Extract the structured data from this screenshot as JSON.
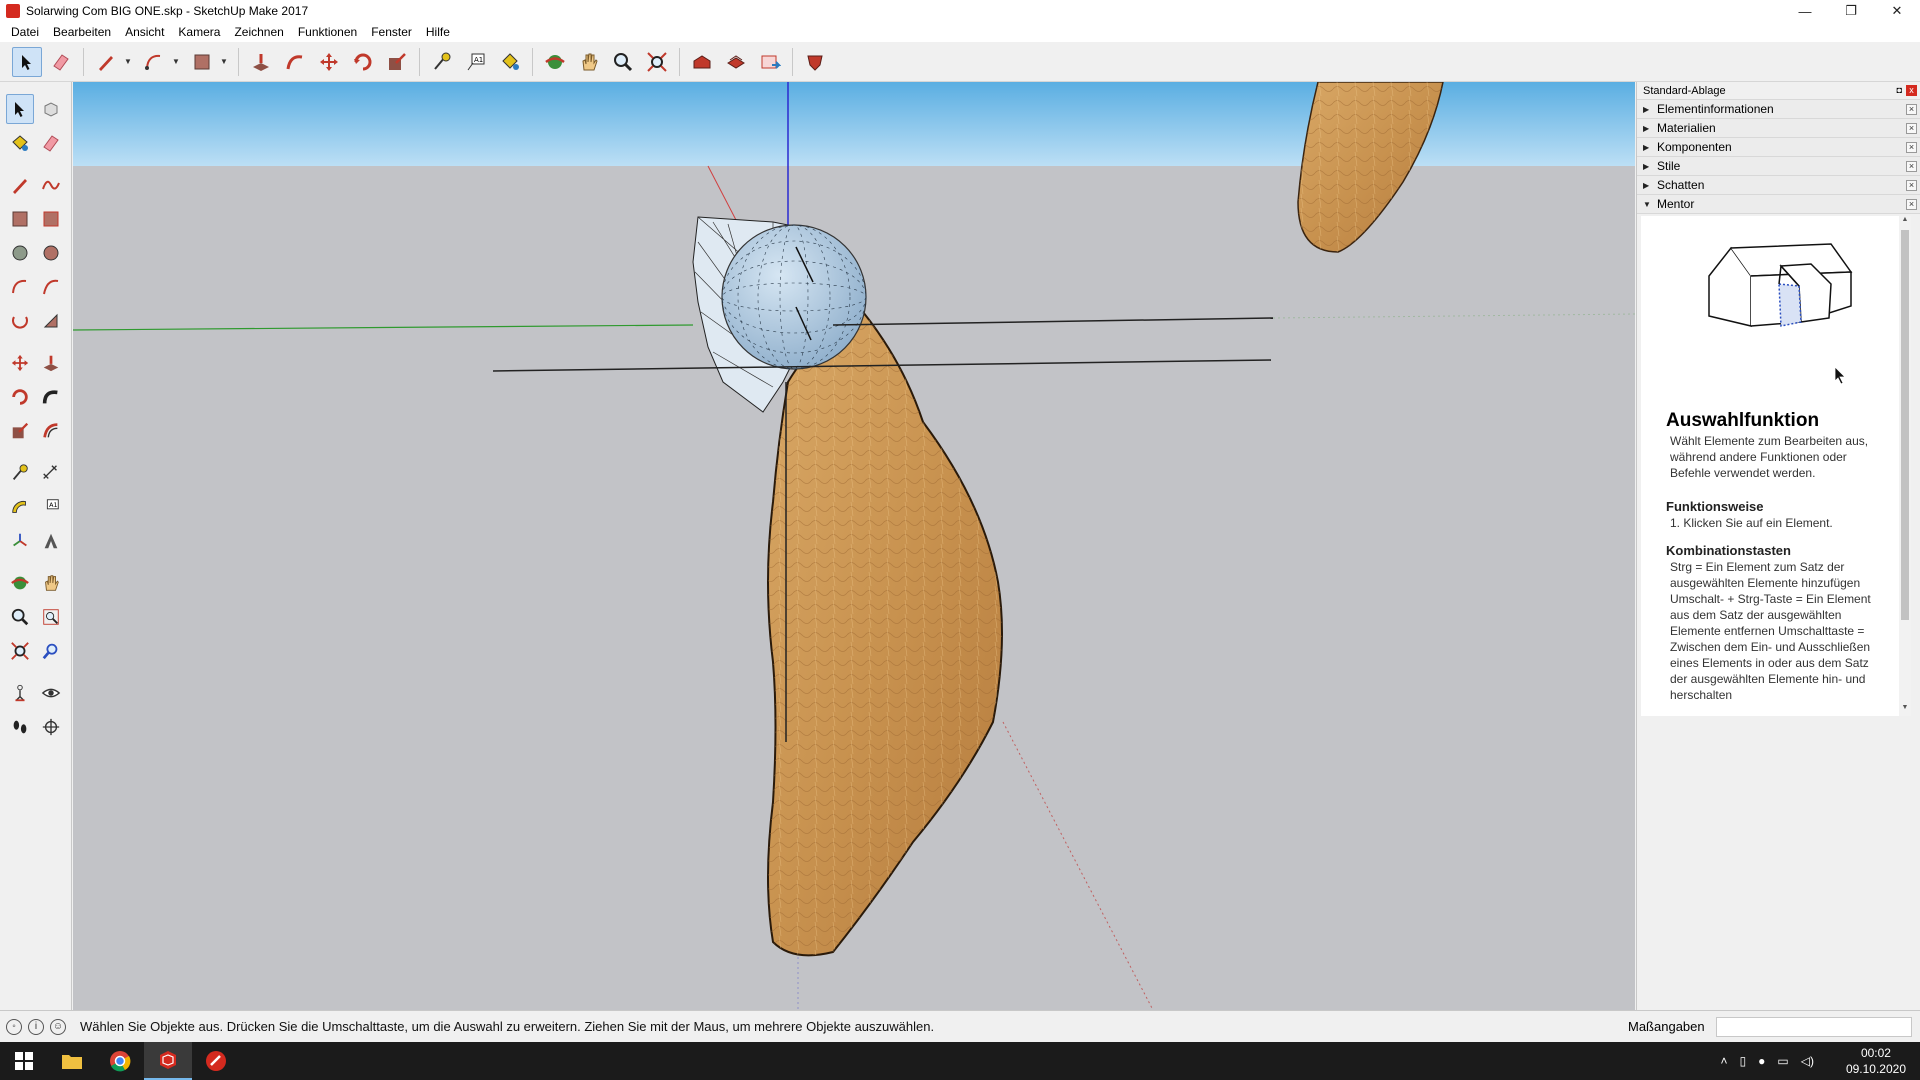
{
  "window": {
    "title": "Solarwing Com BIG ONE.skp - SketchUp Make 2017",
    "minimize": "—",
    "maximize": "❐",
    "close": "✕"
  },
  "menu": [
    "Datei",
    "Bearbeiten",
    "Ansicht",
    "Kamera",
    "Zeichnen",
    "Funktionen",
    "Fenster",
    "Hilfe"
  ],
  "tray": {
    "title": "Standard-Ablage",
    "pin": "◘",
    "close": "x",
    "panels": [
      {
        "label": "Elementinformationen",
        "expanded": false
      },
      {
        "label": "Materialien",
        "expanded": false
      },
      {
        "label": "Komponenten",
        "expanded": false
      },
      {
        "label": "Stile",
        "expanded": false
      },
      {
        "label": "Schatten",
        "expanded": false
      },
      {
        "label": "Mentor",
        "expanded": true
      }
    ]
  },
  "mentor": {
    "heading": "Auswahlfunktion",
    "intro": "Wählt Elemente zum Bearbeiten aus, während andere Funktionen oder Befehle verwendet werden.",
    "section1_title": "Funktionsweise",
    "section1_body": "1. Klicken Sie auf ein Element.",
    "section2_title": "Kombinationstasten",
    "section2_body": "Strg = Ein Element zum Satz der ausgewählten Elemente hinzufügen Umschalt- + Strg-Taste = Ein Element aus dem Satz der ausgewählten Elemente entfernen Umschalttaste = Zwischen dem Ein- und Ausschließen eines Elements in oder aus dem Satz der ausgewählten Elemente hin- und herschalten"
  },
  "status": {
    "message": "Wählen Sie Objekte aus. Drücken Sie die Umschalttaste, um die Auswahl zu erweitern. Ziehen Sie mit der Maus, um mehrere Objekte auszuwählen.",
    "measurements_label": "Maßangaben",
    "measurements_value": ""
  },
  "taskbar": {
    "time": "00:02",
    "date": "09.10.2020"
  },
  "colors": {
    "sky_top": "#5aaee2",
    "sky_bottom": "#bcdff5",
    "ground": "#c2c3c7",
    "leaf": "#c8924f",
    "sphere": "#a9c4dc",
    "accent_red": "#d42a1f"
  }
}
